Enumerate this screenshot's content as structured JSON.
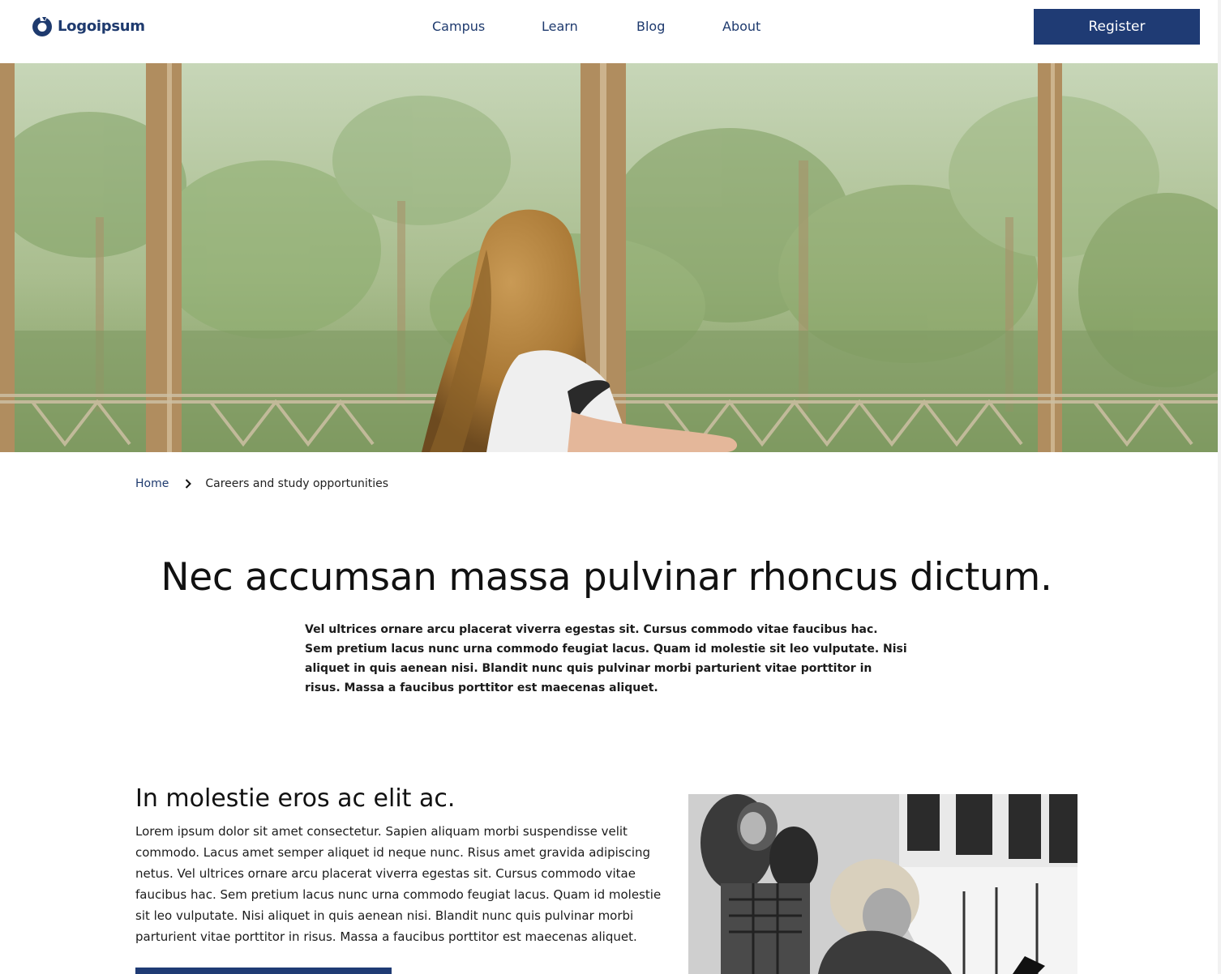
{
  "brand": {
    "name": "Logoipsum",
    "color": "#1e3a6e"
  },
  "nav": {
    "items": [
      {
        "label": "Campus"
      },
      {
        "label": "Learn"
      },
      {
        "label": "Blog"
      },
      {
        "label": "About"
      }
    ],
    "register_label": "Register"
  },
  "breadcrumb": {
    "home": "Home",
    "current": "Careers and study opportunities"
  },
  "hero": {
    "headline": "Nec accumsan massa pulvinar rhoncus dictum.",
    "intro": "Vel ultrices ornare arcu placerat viverra egestas sit. Cursus commodo vitae faucibus hac. Sem pretium lacus nunc urna commodo feugiat lacus. Quam id molestie sit leo vulputate. Nisi aliquet in quis aenean nisi. Blandit nunc quis pulvinar morbi parturient vitae porttitor in risus. Massa a faucibus porttitor est maecenas aliquet."
  },
  "section": {
    "title": "In molestie eros ac elit ac.",
    "body": "Lorem ipsum dolor sit amet consectetur. Sapien aliquam morbi suspendisse velit commodo. Lacus amet semper aliquet id neque nunc. Risus amet gravida adipiscing netus. Vel ultrices ornare arcu placerat viverra egestas sit. Cursus commodo vitae faucibus hac. Sem pretium lacus nunc urna commodo feugiat lacus. Quam id molestie sit leo vulputate. Nisi aliquet in quis aenean nisi. Blandit nunc quis pulvinar morbi parturient vitae porttitor in risus. Massa a faucibus porttitor est maecenas aliquet."
  },
  "colors": {
    "accent": "#1f3b74",
    "text": "#111111"
  },
  "icons": {
    "logo": "logo-mark-icon",
    "breadcrumb_separator": "chevron-right-icon"
  }
}
